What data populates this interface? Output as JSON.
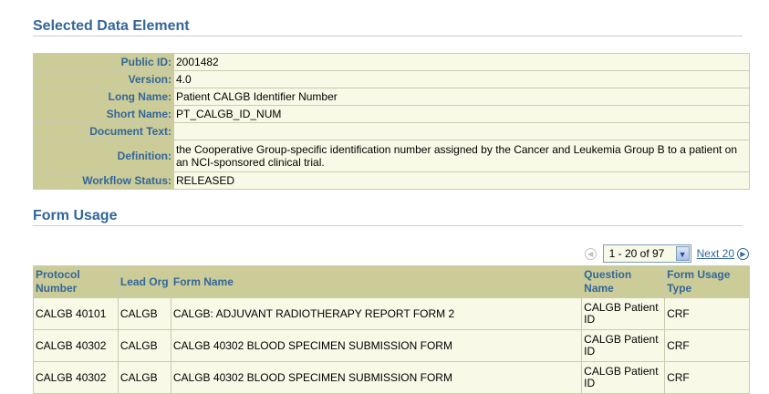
{
  "selected": {
    "title": "Selected Data Element",
    "fields": [
      {
        "label": "Public ID:",
        "value": "2001482"
      },
      {
        "label": "Version:",
        "value": "4.0"
      },
      {
        "label": "Long Name:",
        "value": "Patient CALGB Identifier Number"
      },
      {
        "label": "Short Name:",
        "value": "PT_CALGB_ID_NUM"
      },
      {
        "label": "Document Text:",
        "value": ""
      },
      {
        "label": "Definition:",
        "value": "the Cooperative Group-specific identification number assigned by the Cancer and Leukemia Group B to a patient on an NCI-sponsored clinical trial."
      },
      {
        "label": "Workflow Status:",
        "value": "RELEASED"
      }
    ]
  },
  "usage": {
    "title": "Form Usage",
    "pager": {
      "range": "1 - 20 of 97",
      "next_label": "Next 20",
      "prev_icon": "previous-arrow-icon",
      "next_icon": "next-arrow-icon"
    },
    "columns": [
      "Protocol Number",
      "Lead Org",
      "Form Name",
      "Question Name",
      "Form Usage Type"
    ],
    "rows": [
      [
        "CALGB 40101",
        "CALGB",
        "CALGB: ADJUVANT RADIOTHERAPY REPORT FORM 2",
        "CALGB Patient ID",
        "CRF"
      ],
      [
        "CALGB 40302",
        "CALGB",
        "CALGB 40302 BLOOD SPECIMEN SUBMISSION FORM",
        "CALGB Patient ID",
        "CRF"
      ],
      [
        "CALGB 40302",
        "CALGB",
        "CALGB 40302 BLOOD SPECIMEN SUBMISSION FORM",
        "CALGB Patient ID",
        "CRF"
      ]
    ]
  },
  "colors": {
    "heading": "#336699",
    "label_bg": "#cccc99",
    "cell_bg": "#f9f9e7"
  }
}
